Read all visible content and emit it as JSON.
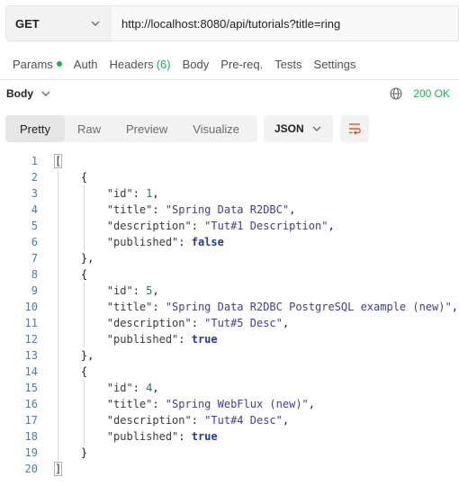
{
  "request": {
    "method": "GET",
    "url": "http://localhost:8080/api/tutorials?title=ring"
  },
  "request_tabs": [
    {
      "label": "Params",
      "dot": true
    },
    {
      "label": "Auth"
    },
    {
      "label": "Headers",
      "count": "(6)"
    },
    {
      "label": "Body"
    },
    {
      "label": "Pre-req."
    },
    {
      "label": "Tests"
    },
    {
      "label": "Settings"
    }
  ],
  "response": {
    "section_label": "Body",
    "status": "200 OK",
    "view_tabs": [
      "Pretty",
      "Raw",
      "Preview",
      "Visualize"
    ],
    "active_view": "Pretty",
    "format": "JSON"
  },
  "icons": {
    "method_dropdown": "chevron-down-icon",
    "body_dropdown": "chevron-down-icon",
    "network": "globe-icon",
    "format_dropdown": "chevron-down-icon",
    "wrap": "wrap-lines-icon"
  },
  "colors": {
    "status_ok": "#0cbb52",
    "wrap_icon": "#e8502e",
    "line_numbers": "#4a7dac"
  },
  "code_lines": [
    {
      "n": "1",
      "text": "["
    },
    {
      "n": "2",
      "text": "    {"
    },
    {
      "n": "3",
      "text": "        \"id\": 1,"
    },
    {
      "n": "4",
      "text": "        \"title\": \"Spring Data R2DBC\","
    },
    {
      "n": "5",
      "text": "        \"description\": \"Tut#1 Description\","
    },
    {
      "n": "6",
      "text": "        \"published\": false"
    },
    {
      "n": "7",
      "text": "    },"
    },
    {
      "n": "8",
      "text": "    {"
    },
    {
      "n": "9",
      "text": "        \"id\": 5,"
    },
    {
      "n": "10",
      "text": "        \"title\": \"Spring Data R2DBC PostgreSQL example (new)\","
    },
    {
      "n": "11",
      "text": "        \"description\": \"Tut#5 Desc\","
    },
    {
      "n": "12",
      "text": "        \"published\": true"
    },
    {
      "n": "13",
      "text": "    },"
    },
    {
      "n": "14",
      "text": "    {"
    },
    {
      "n": "15",
      "text": "        \"id\": 4,"
    },
    {
      "n": "16",
      "text": "        \"title\": \"Spring WebFlux (new)\","
    },
    {
      "n": "17",
      "text": "        \"description\": \"Tut#4 Desc\","
    },
    {
      "n": "18",
      "text": "        \"published\": true"
    },
    {
      "n": "19",
      "text": "    }"
    },
    {
      "n": "20",
      "text": "]"
    }
  ]
}
